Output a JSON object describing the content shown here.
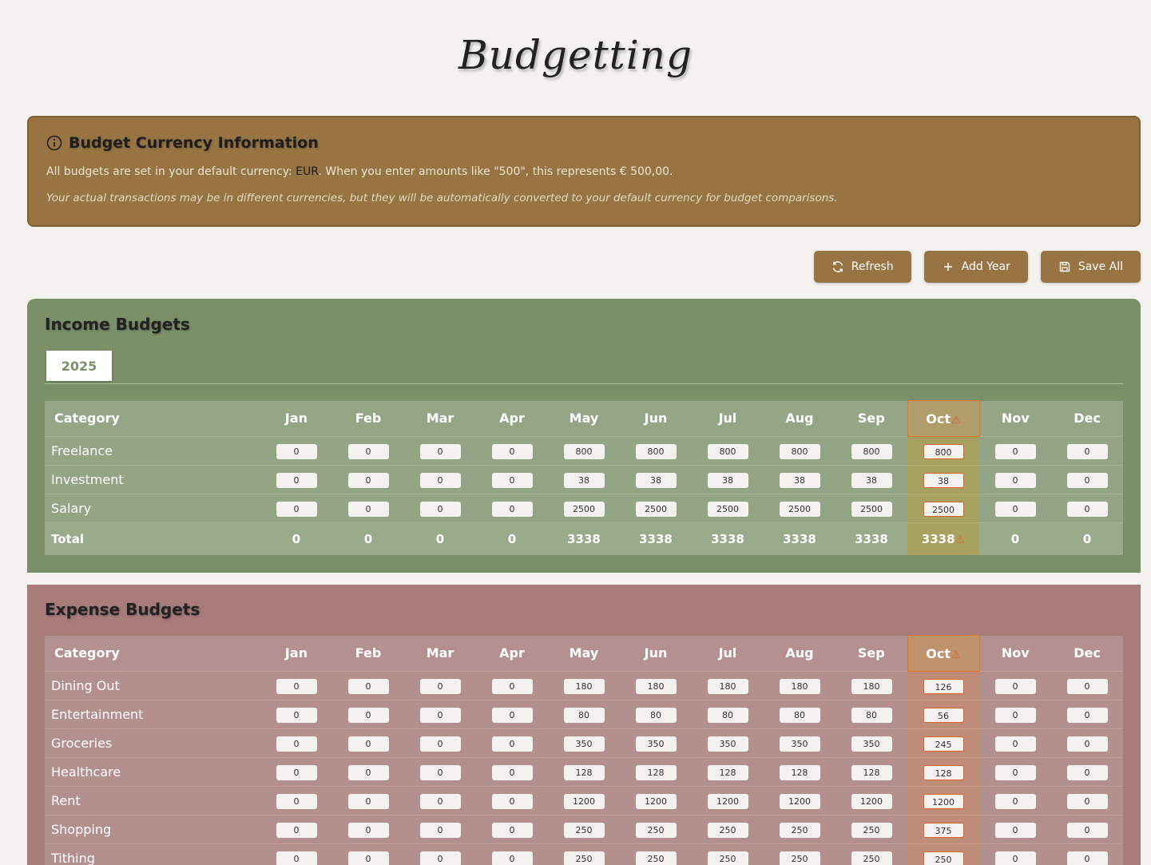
{
  "page": {
    "title": "Budgetting"
  },
  "info": {
    "title": "Budget Currency Information",
    "line1_pre": "All budgets are set in your default currency: ",
    "currency": "EUR",
    "line1_post": ". When you enter amounts like \"500\", this represents € 500,00.",
    "line2": "Your actual transactions may be in different currencies, but they will be automatically converted to your default currency for budget comparisons."
  },
  "actions": {
    "refresh": "Refresh",
    "add_year": "Add Year",
    "save_all": "Save All"
  },
  "months": [
    "Jan",
    "Feb",
    "Mar",
    "Apr",
    "May",
    "Jun",
    "Jul",
    "Aug",
    "Sep",
    "Oct",
    "Nov",
    "Dec"
  ],
  "current_month": "Oct",
  "income": {
    "title": "Income Budgets",
    "year_tab": "2025",
    "category_header": "Category",
    "rows": [
      {
        "name": "Freelance",
        "values": [
          "0",
          "0",
          "0",
          "0",
          "800",
          "800",
          "800",
          "800",
          "800",
          "800",
          "0",
          "0"
        ]
      },
      {
        "name": "Investment",
        "values": [
          "0",
          "0",
          "0",
          "0",
          "38",
          "38",
          "38",
          "38",
          "38",
          "38",
          "0",
          "0"
        ]
      },
      {
        "name": "Salary",
        "values": [
          "0",
          "0",
          "0",
          "0",
          "2500",
          "2500",
          "2500",
          "2500",
          "2500",
          "2500",
          "0",
          "0"
        ]
      }
    ],
    "total": {
      "name": "Total",
      "values": [
        "0",
        "0",
        "0",
        "0",
        "3338",
        "3338",
        "3338",
        "3338",
        "3338",
        "3338",
        "0",
        "0"
      ]
    }
  },
  "expense": {
    "title": "Expense Budgets",
    "category_header": "Category",
    "rows": [
      {
        "name": "Dining Out",
        "values": [
          "0",
          "0",
          "0",
          "0",
          "180",
          "180",
          "180",
          "180",
          "180",
          "126",
          "0",
          "0"
        ]
      },
      {
        "name": "Entertainment",
        "values": [
          "0",
          "0",
          "0",
          "0",
          "80",
          "80",
          "80",
          "80",
          "80",
          "56",
          "0",
          "0"
        ]
      },
      {
        "name": "Groceries",
        "values": [
          "0",
          "0",
          "0",
          "0",
          "350",
          "350",
          "350",
          "350",
          "350",
          "245",
          "0",
          "0"
        ]
      },
      {
        "name": "Healthcare",
        "values": [
          "0",
          "0",
          "0",
          "0",
          "128",
          "128",
          "128",
          "128",
          "128",
          "128",
          "0",
          "0"
        ]
      },
      {
        "name": "Rent",
        "values": [
          "0",
          "0",
          "0",
          "0",
          "1200",
          "1200",
          "1200",
          "1200",
          "1200",
          "1200",
          "0",
          "0"
        ]
      },
      {
        "name": "Shopping",
        "values": [
          "0",
          "0",
          "0",
          "0",
          "250",
          "250",
          "250",
          "250",
          "250",
          "375",
          "0",
          "0"
        ]
      },
      {
        "name": "Tithing",
        "values": [
          "0",
          "0",
          "0",
          "0",
          "250",
          "250",
          "250",
          "250",
          "250",
          "250",
          "0",
          "0"
        ]
      }
    ]
  },
  "colors": {
    "accent": "#987443",
    "income_bg": "#7b8f69",
    "expense_bg": "#a77c7b",
    "warning": "#e0622e"
  },
  "icons": {
    "info": "info-circle-icon",
    "refresh": "refresh-icon",
    "add": "plus-icon",
    "save": "save-icon",
    "warning": "warning-triangle-icon"
  }
}
